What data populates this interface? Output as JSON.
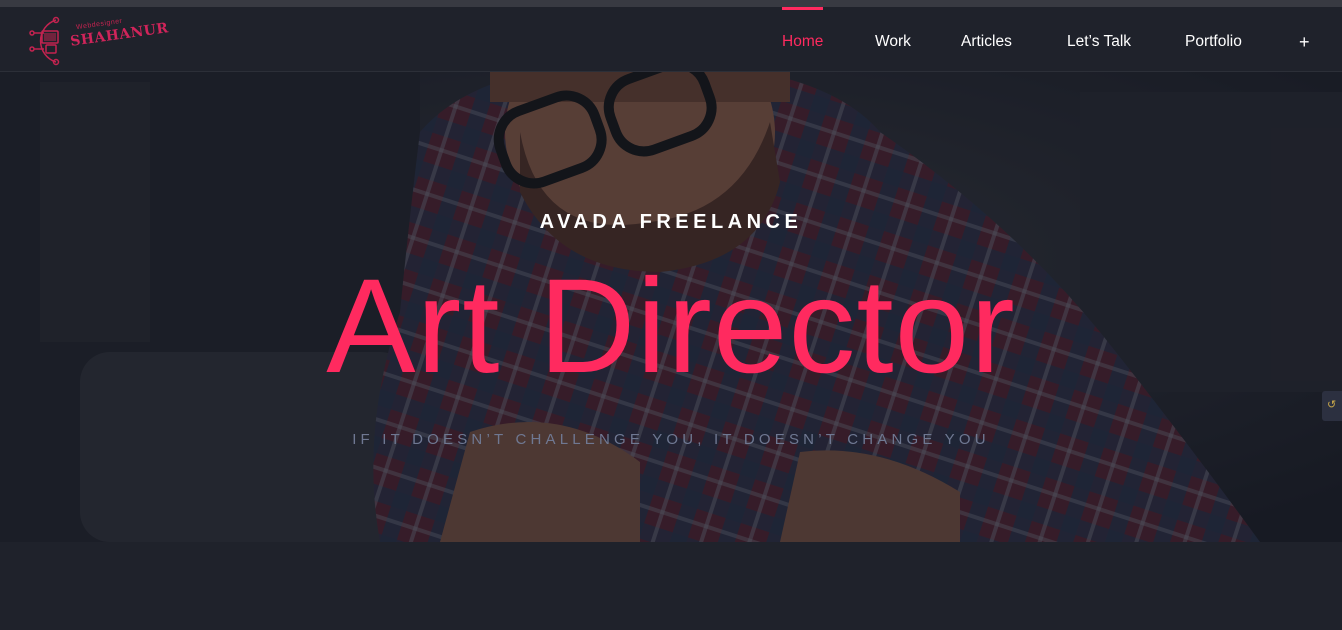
{
  "brand": {
    "logo_small_text": "Webdesigner",
    "logo_main_text": "SHAHANUR",
    "accent_color": "#ff2a5f",
    "logo_color": "#d0245a"
  },
  "nav": {
    "items": [
      {
        "label": "Home",
        "active": true
      },
      {
        "label": "Work"
      },
      {
        "label": "Articles"
      },
      {
        "label": "Let’s Talk"
      },
      {
        "label": "Portfolio"
      },
      {
        "label": "+"
      }
    ]
  },
  "hero": {
    "eyebrow": "AVADA FREELANCE",
    "headline": "Art Director",
    "tagline": "IF IT DOESN’T CHALLENGE YOU, IT DOESN’T CHANGE YOU"
  },
  "side_tab": {
    "icon": "scroll-tab-icon"
  }
}
